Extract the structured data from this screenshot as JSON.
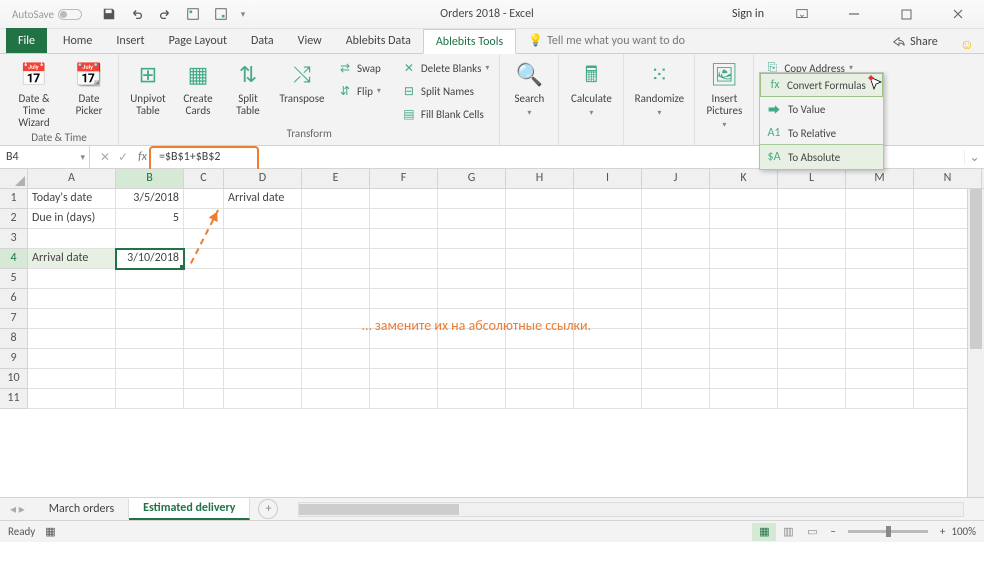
{
  "autosave_label": "AutoSave",
  "title": "Orders 2018 - Excel",
  "signin": "Sign in",
  "tabs": {
    "file": "File",
    "home": "Home",
    "insert": "Insert",
    "page_layout": "Page Layout",
    "data": "Data",
    "view": "View",
    "ab_data": "Ablebits Data",
    "ab_tools": "Ablebits Tools",
    "tell": "Tell me what you want to do",
    "share": "Share"
  },
  "ribbon": {
    "dt": {
      "wiz": "Date & Time Wizard",
      "picker": "Date Picker",
      "group": "Date & Time"
    },
    "tr": {
      "unpivot": "Unpivot Table",
      "cards": "Create Cards",
      "split": "Split Table",
      "transpose": "Transpose",
      "swap": "Swap",
      "flip": "Flip",
      "del": "Delete Blanks",
      "splitnames": "Split Names",
      "fill": "Fill Blank Cells",
      "group": "Transform"
    },
    "search": "Search",
    "calc": "Calculate",
    "rand": "Randomize",
    "ins": "Insert Pictures",
    "copyaddr": "Copy Address",
    "menu": {
      "head": "Convert Formulas",
      "val": "To Value",
      "rel": "To Relative",
      "abs": "To Absolute"
    }
  },
  "namebox": "B4",
  "formula": "=$B$1+$B$2",
  "cols": [
    "A",
    "B",
    "C",
    "D",
    "E",
    "F",
    "G",
    "H",
    "I",
    "J",
    "K",
    "L",
    "M",
    "N"
  ],
  "cells": {
    "a1": "Today's date",
    "b1": "3/5/2018",
    "d1": "Arrival date",
    "a2": "Due in (days)",
    "b2": "5",
    "a4": "Arrival date",
    "b4": "3/10/2018"
  },
  "annotation": "… замените их на абсолютные ссылки.",
  "sheets": {
    "s1": "March orders",
    "s2": "Estimated delivery"
  },
  "status": {
    "ready": "Ready",
    "zoom": "100%"
  }
}
